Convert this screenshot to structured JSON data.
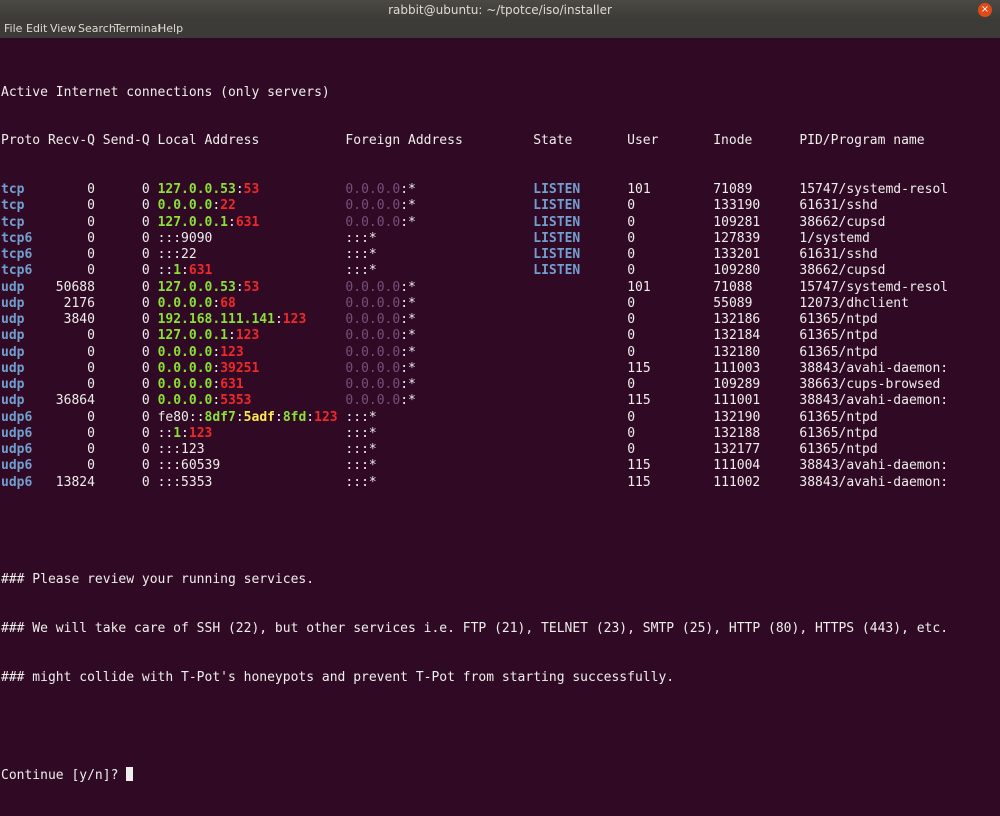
{
  "window": {
    "title": "rabbit@ubuntu: ~/tpotce/iso/installer",
    "close_glyph": "×",
    "menu": [
      "File",
      "Edit",
      "View",
      "Search",
      "Terminal",
      "Help"
    ]
  },
  "terminal": {
    "heading": "Active Internet connections (only servers)",
    "columns": "Proto Recv-Q Send-Q Local Address           Foreign Address         State       User       Inode      PID/Program name",
    "rows": [
      {
        "proto": "tcp",
        "recv": "0",
        "send": "0",
        "local": [
          {
            "t": "127.0.0.53",
            "c": "ip"
          },
          {
            "t": ":",
            "c": ""
          },
          {
            "t": "53",
            "c": "port"
          }
        ],
        "foreign": [
          {
            "t": "0.0.0.0",
            "c": "dim"
          },
          {
            "t": ":*",
            "c": ""
          }
        ],
        "state": "LISTEN",
        "user": "101",
        "inode": "71089",
        "pid": "15747/systemd-resol"
      },
      {
        "proto": "tcp",
        "recv": "0",
        "send": "0",
        "local": [
          {
            "t": "0.0.0.0",
            "c": "ip"
          },
          {
            "t": ":",
            "c": ""
          },
          {
            "t": "22",
            "c": "port"
          }
        ],
        "foreign": [
          {
            "t": "0.0.0.0",
            "c": "dim"
          },
          {
            "t": ":*",
            "c": ""
          }
        ],
        "state": "LISTEN",
        "user": "0",
        "inode": "133190",
        "pid": "61631/sshd"
      },
      {
        "proto": "tcp",
        "recv": "0",
        "send": "0",
        "local": [
          {
            "t": "127.0.0.1",
            "c": "ip"
          },
          {
            "t": ":",
            "c": ""
          },
          {
            "t": "631",
            "c": "port"
          }
        ],
        "foreign": [
          {
            "t": "0.0.0.0",
            "c": "dim"
          },
          {
            "t": ":*",
            "c": ""
          }
        ],
        "state": "LISTEN",
        "user": "0",
        "inode": "109281",
        "pid": "38662/cupsd"
      },
      {
        "proto": "tcp6",
        "recv": "0",
        "send": "0",
        "local": [
          {
            "t": ":::9090",
            "c": ""
          }
        ],
        "foreign": [
          {
            "t": ":::*",
            "c": ""
          }
        ],
        "state": "LISTEN",
        "user": "0",
        "inode": "127839",
        "pid": "1/systemd"
      },
      {
        "proto": "tcp6",
        "recv": "0",
        "send": "0",
        "local": [
          {
            "t": ":::22",
            "c": ""
          }
        ],
        "foreign": [
          {
            "t": ":::*",
            "c": ""
          }
        ],
        "state": "LISTEN",
        "user": "0",
        "inode": "133201",
        "pid": "61631/sshd"
      },
      {
        "proto": "tcp6",
        "recv": "0",
        "send": "0",
        "local": [
          {
            "t": "::",
            "c": ""
          },
          {
            "t": "1",
            "c": "ip"
          },
          {
            "t": ":",
            "c": ""
          },
          {
            "t": "631",
            "c": "port"
          }
        ],
        "foreign": [
          {
            "t": ":::*",
            "c": ""
          }
        ],
        "state": "LISTEN",
        "user": "0",
        "inode": "109280",
        "pid": "38662/cupsd"
      },
      {
        "proto": "udp",
        "recv": "50688",
        "send": "0",
        "local": [
          {
            "t": "127.0.0.53",
            "c": "ip"
          },
          {
            "t": ":",
            "c": ""
          },
          {
            "t": "53",
            "c": "port"
          }
        ],
        "foreign": [
          {
            "t": "0.0.0.0",
            "c": "dim"
          },
          {
            "t": ":*",
            "c": ""
          }
        ],
        "state": "",
        "user": "101",
        "inode": "71088",
        "pid": "15747/systemd-resol"
      },
      {
        "proto": "udp",
        "recv": "2176",
        "send": "0",
        "local": [
          {
            "t": "0.0.0.0",
            "c": "ip"
          },
          {
            "t": ":",
            "c": ""
          },
          {
            "t": "68",
            "c": "port"
          }
        ],
        "foreign": [
          {
            "t": "0.0.0.0",
            "c": "dim"
          },
          {
            "t": ":*",
            "c": ""
          }
        ],
        "state": "",
        "user": "0",
        "inode": "55089",
        "pid": "12073/dhclient"
      },
      {
        "proto": "udp",
        "recv": "3840",
        "send": "0",
        "local": [
          {
            "t": "192.168.111.141",
            "c": "ip"
          },
          {
            "t": ":",
            "c": ""
          },
          {
            "t": "123",
            "c": "port"
          }
        ],
        "foreign": [
          {
            "t": "0.0.0.0",
            "c": "dim"
          },
          {
            "t": ":*",
            "c": ""
          }
        ],
        "state": "",
        "user": "0",
        "inode": "132186",
        "pid": "61365/ntpd"
      },
      {
        "proto": "udp",
        "recv": "0",
        "send": "0",
        "local": [
          {
            "t": "127.0.0.1",
            "c": "ip"
          },
          {
            "t": ":",
            "c": ""
          },
          {
            "t": "123",
            "c": "port"
          }
        ],
        "foreign": [
          {
            "t": "0.0.0.0",
            "c": "dim"
          },
          {
            "t": ":*",
            "c": ""
          }
        ],
        "state": "",
        "user": "0",
        "inode": "132184",
        "pid": "61365/ntpd"
      },
      {
        "proto": "udp",
        "recv": "0",
        "send": "0",
        "local": [
          {
            "t": "0.0.0.0",
            "c": "ip"
          },
          {
            "t": ":",
            "c": ""
          },
          {
            "t": "123",
            "c": "port"
          }
        ],
        "foreign": [
          {
            "t": "0.0.0.0",
            "c": "dim"
          },
          {
            "t": ":*",
            "c": ""
          }
        ],
        "state": "",
        "user": "0",
        "inode": "132180",
        "pid": "61365/ntpd"
      },
      {
        "proto": "udp",
        "recv": "0",
        "send": "0",
        "local": [
          {
            "t": "0.0.0.0",
            "c": "ip"
          },
          {
            "t": ":",
            "c": ""
          },
          {
            "t": "39251",
            "c": "port"
          }
        ],
        "foreign": [
          {
            "t": "0.0.0.0",
            "c": "dim"
          },
          {
            "t": ":*",
            "c": ""
          }
        ],
        "state": "",
        "user": "115",
        "inode": "111003",
        "pid": "38843/avahi-daemon:"
      },
      {
        "proto": "udp",
        "recv": "0",
        "send": "0",
        "local": [
          {
            "t": "0.0.0.0",
            "c": "ip"
          },
          {
            "t": ":",
            "c": ""
          },
          {
            "t": "631",
            "c": "port"
          }
        ],
        "foreign": [
          {
            "t": "0.0.0.0",
            "c": "dim"
          },
          {
            "t": ":*",
            "c": ""
          }
        ],
        "state": "",
        "user": "0",
        "inode": "109289",
        "pid": "38663/cups-browsed"
      },
      {
        "proto": "udp",
        "recv": "36864",
        "send": "0",
        "local": [
          {
            "t": "0.0.0.0",
            "c": "ip"
          },
          {
            "t": ":",
            "c": ""
          },
          {
            "t": "5353",
            "c": "port"
          }
        ],
        "foreign": [
          {
            "t": "0.0.0.0",
            "c": "dim"
          },
          {
            "t": ":*",
            "c": ""
          }
        ],
        "state": "",
        "user": "115",
        "inode": "111001",
        "pid": "38843/avahi-daemon:"
      },
      {
        "proto": "udp6",
        "recv": "0",
        "send": "0",
        "local": [
          {
            "t": "fe80",
            "c": ""
          },
          {
            "t": "::",
            "c": ""
          },
          {
            "t": "8df7",
            "c": "ip"
          },
          {
            "t": ":",
            "c": ""
          },
          {
            "t": "5adf",
            "c": "y"
          },
          {
            "t": ":",
            "c": ""
          },
          {
            "t": "8fd",
            "c": "ip"
          },
          {
            "t": ":",
            "c": ""
          },
          {
            "t": "123",
            "c": "port"
          }
        ],
        "foreign": [
          {
            "t": ":::*",
            "c": ""
          }
        ],
        "state": "",
        "user": "0",
        "inode": "132190",
        "pid": "61365/ntpd"
      },
      {
        "proto": "udp6",
        "recv": "0",
        "send": "0",
        "local": [
          {
            "t": "::",
            "c": ""
          },
          {
            "t": "1",
            "c": "ip"
          },
          {
            "t": ":",
            "c": ""
          },
          {
            "t": "123",
            "c": "port"
          }
        ],
        "foreign": [
          {
            "t": ":::*",
            "c": ""
          }
        ],
        "state": "",
        "user": "0",
        "inode": "132188",
        "pid": "61365/ntpd"
      },
      {
        "proto": "udp6",
        "recv": "0",
        "send": "0",
        "local": [
          {
            "t": ":::123",
            "c": ""
          }
        ],
        "foreign": [
          {
            "t": ":::*",
            "c": ""
          }
        ],
        "state": "",
        "user": "0",
        "inode": "132177",
        "pid": "61365/ntpd"
      },
      {
        "proto": "udp6",
        "recv": "0",
        "send": "0",
        "local": [
          {
            "t": ":::60539",
            "c": ""
          }
        ],
        "foreign": [
          {
            "t": ":::*",
            "c": ""
          }
        ],
        "state": "",
        "user": "115",
        "inode": "111004",
        "pid": "38843/avahi-daemon:"
      },
      {
        "proto": "udp6",
        "recv": "13824",
        "send": "0",
        "local": [
          {
            "t": ":::5353",
            "c": ""
          }
        ],
        "foreign": [
          {
            "t": ":::*",
            "c": ""
          }
        ],
        "state": "",
        "user": "115",
        "inode": "111002",
        "pid": "38843/avahi-daemon:"
      }
    ],
    "messages": [
      "### Please review your running services.",
      "### We will take care of SSH (22), but other services i.e. FTP (21), TELNET (23), SMTP (25), HTTP (80), HTTPS (443), etc.",
      "### might collide with T-Pot's honeypots and prevent T-Pot from starting successfully."
    ],
    "prompt": "Continue [y/n]? "
  },
  "colors": {
    "background": "#300a24",
    "text": "#eeeeec",
    "proto": "#729fcf",
    "ip": "#8ae234",
    "port": "#ef2929",
    "dim": "#75507b"
  }
}
